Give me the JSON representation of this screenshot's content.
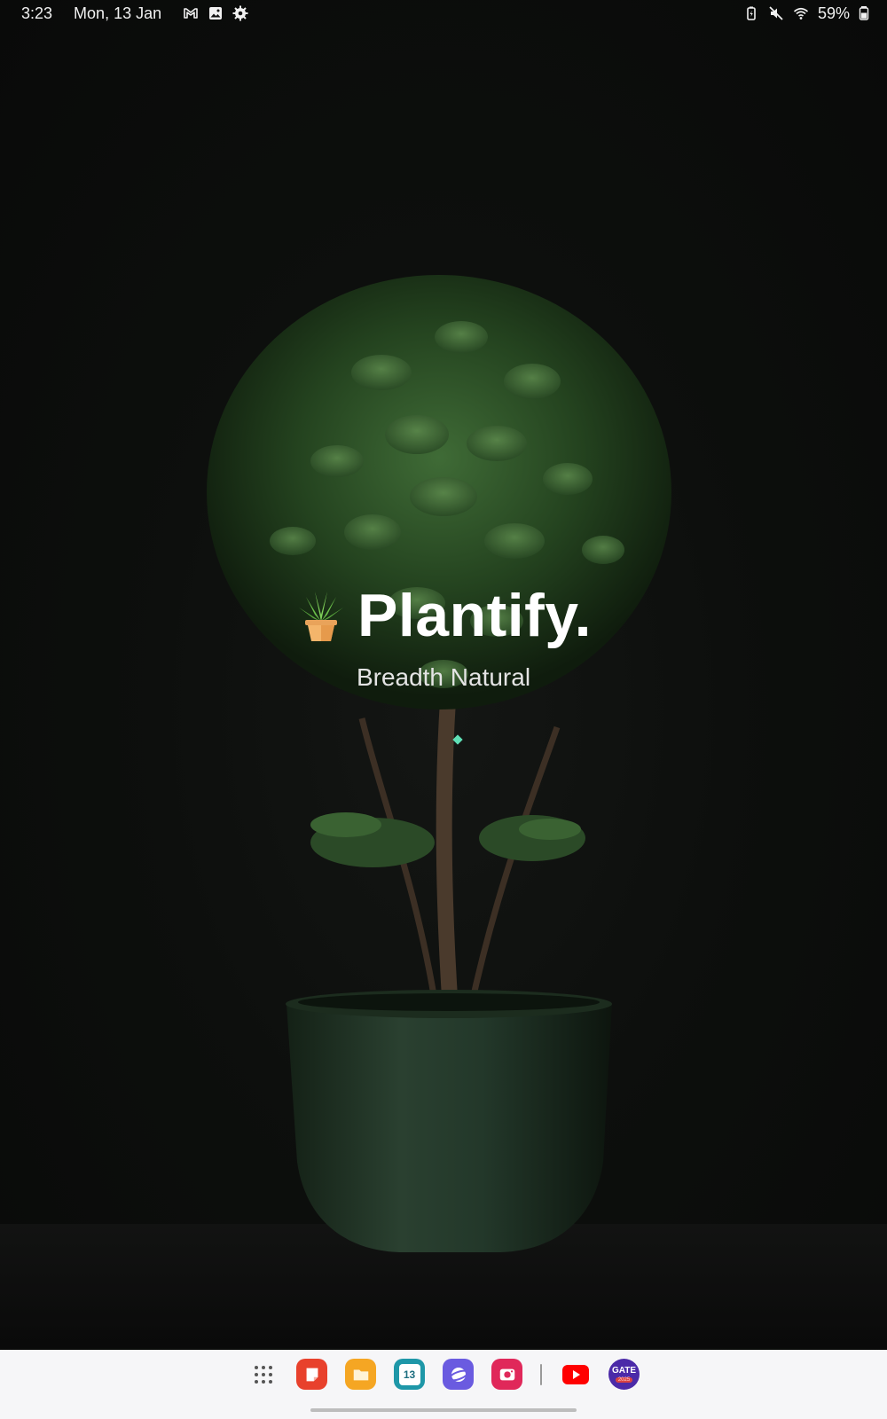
{
  "status_bar": {
    "time": "3:23",
    "date": "Mon, 13 Jan",
    "battery": "59%",
    "left_icons": [
      "gmail-icon",
      "gallery-icon",
      "settings-icon"
    ],
    "right_icons": [
      "battery-saver-icon",
      "mute-icon",
      "wifi-icon",
      "battery-icon"
    ]
  },
  "splash": {
    "title": "Plantify.",
    "subtitle": "Breadth Natural",
    "logo_icon": "potted-plant-icon",
    "loader_color": "#5fe0b6"
  },
  "dock": {
    "apps": [
      {
        "name": "app-drawer",
        "icon": "grid-dots-icon"
      },
      {
        "name": "samsung-notes",
        "icon": "notes-icon",
        "color": "#e8412c"
      },
      {
        "name": "my-files",
        "icon": "folder-icon",
        "color": "#f5a623"
      },
      {
        "name": "calendar",
        "icon": "calendar-icon",
        "color": "#1e97a8",
        "label": "13"
      },
      {
        "name": "samsung-internet",
        "icon": "browser-icon",
        "color": "#6a5be0"
      },
      {
        "name": "screen-recorder",
        "icon": "camera-icon",
        "color": "#e0285a"
      },
      {
        "name": "youtube",
        "icon": "youtube-icon",
        "color": "#ff0000"
      },
      {
        "name": "gate-2025",
        "icon": "gate-icon",
        "color": "#4b2aa8",
        "label": "GATE",
        "sublabel": "2025"
      }
    ]
  }
}
